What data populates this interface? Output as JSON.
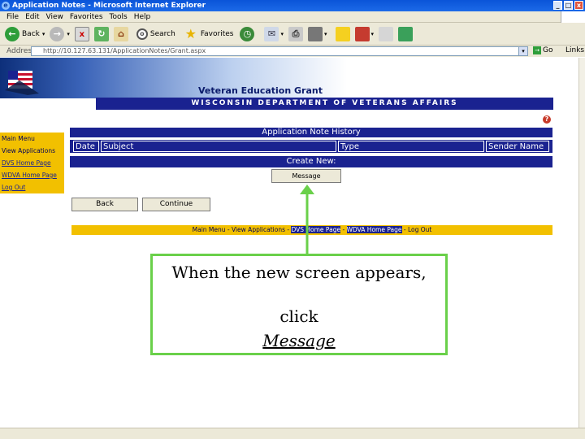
{
  "window": {
    "title": "Application Notes - Microsoft Internet Explorer",
    "controls": [
      "_",
      "□",
      "x"
    ]
  },
  "menu": [
    "File",
    "Edit",
    "View",
    "Favorites",
    "Tools",
    "Help"
  ],
  "toolbar": {
    "back_label": "Back",
    "search_label": "Search",
    "favorites_label": "Favorites"
  },
  "addressbar": {
    "label": "Address",
    "url": "http://10.127.63.131/ApplicationNotes/Grant.aspx",
    "go_label": "Go",
    "links_label": "Links"
  },
  "site": {
    "grant_title": "Veteran Education Grant",
    "department": "WISCONSIN DEPARTMENT OF VETERANS AFFAIRS",
    "help": "?"
  },
  "leftnav": [
    {
      "label": "Main Menu"
    },
    {
      "label": "View Applications"
    },
    {
      "label": "DVS Home Page"
    },
    {
      "label": "WDVA Home Page"
    },
    {
      "label": "Log Out"
    }
  ],
  "notes": {
    "header": "Application Note History",
    "columns": [
      "Date",
      "Subject",
      "Type",
      "Sender Name"
    ],
    "create_header": "Create New:",
    "message_button": "Message"
  },
  "buttons": {
    "back": "Back",
    "continue": "Continue"
  },
  "footer_nav": {
    "main_menu": "Main Menu",
    "view_applications": "View Applications",
    "dvs_home": "DVS Home Page",
    "wdva_home": "WDVA Home Page",
    "log_out": "Log Out",
    "sep": " - "
  },
  "callout": {
    "line1": "When the new screen appears,",
    "line2": "click",
    "line3": "Message",
    "border_color": "#6ad04a"
  },
  "colors": {
    "navy": "#1a2290",
    "yellow": "#f2c000",
    "arrow_green": "#6ad04a"
  }
}
